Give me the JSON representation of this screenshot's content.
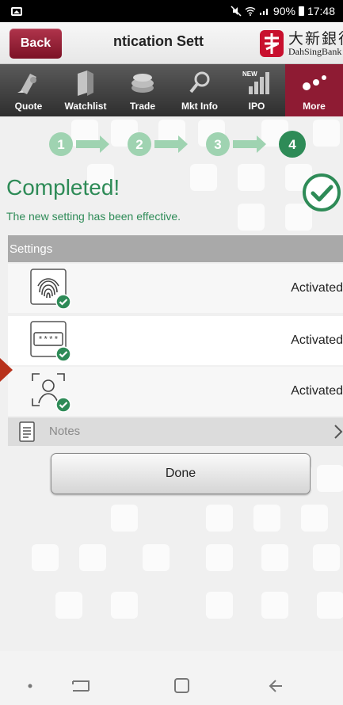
{
  "status_bar": {
    "signal": "90%",
    "time": "17:48"
  },
  "header": {
    "back_label": "Back",
    "title": "ntication Sett",
    "logo_cn": "大新銀行",
    "logo_en": "DahSingBank"
  },
  "tabs": [
    {
      "label": "Quote",
      "icon": "quote-icon"
    },
    {
      "label": "Watchlist",
      "icon": "watchlist-icon"
    },
    {
      "label": "Trade",
      "icon": "trade-icon"
    },
    {
      "label": "Mkt Info",
      "icon": "mkt-info-icon"
    },
    {
      "label": "IPO",
      "icon": "ipo-icon",
      "badge": "NEW"
    },
    {
      "label": "More",
      "icon": "more-icon",
      "active": true
    }
  ],
  "steps": {
    "labels": [
      "1",
      "2",
      "3",
      "4"
    ],
    "current": 4
  },
  "completion": {
    "title": "Completed!",
    "subtitle": "The new setting has been effective."
  },
  "settings": {
    "header": "Settings",
    "items": [
      {
        "icon": "fingerprint-icon",
        "status": "Activated"
      },
      {
        "icon": "pin-code-icon",
        "pin_mask": "****",
        "status": "Activated"
      },
      {
        "icon": "face-id-icon",
        "status": "Activated"
      }
    ]
  },
  "notes": {
    "label": "Notes"
  },
  "done_label": "Done",
  "colors": {
    "accent_red": "#8e1b33",
    "success_green": "#2e8b57",
    "step_done": "#9fd3b1",
    "step_current": "#2e8b57"
  }
}
